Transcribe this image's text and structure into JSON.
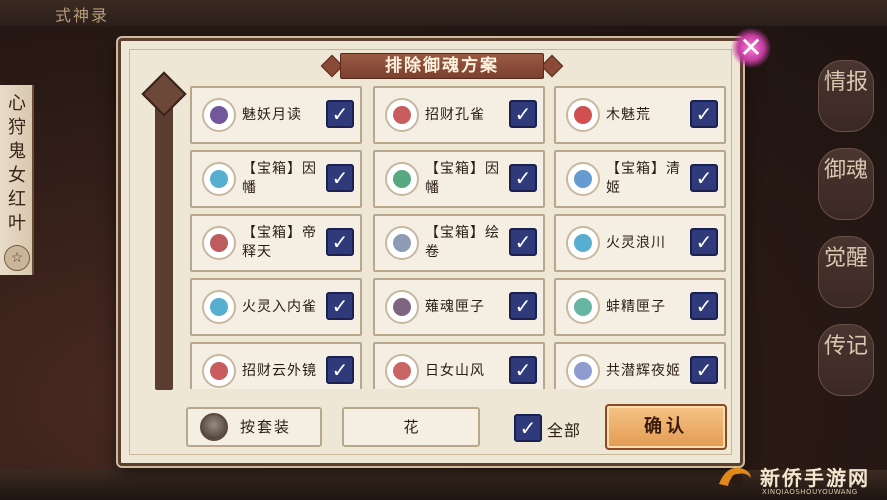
{
  "header": {
    "title": "式神录"
  },
  "left_panel": {
    "name": "心狩鬼女红叶",
    "button": "☆"
  },
  "right_tabs": [
    "情报",
    "御魂",
    "觉醒",
    "传记"
  ],
  "dialog": {
    "title": "排除御魂方案",
    "close": "✕",
    "cards": [
      {
        "label": "魅妖月读",
        "checked": "✓",
        "accent": "#5a3a8a"
      },
      {
        "label": "招财孔雀",
        "checked": "✓",
        "accent": "#c04040"
      },
      {
        "label": "木魅荒",
        "checked": "✓",
        "accent": "#c83030"
      },
      {
        "label": "【宝箱】因幡",
        "checked": "✓",
        "accent": "#3aa0c8"
      },
      {
        "label": "【宝箱】因幡",
        "checked": "✓",
        "accent": "#3a9a6a"
      },
      {
        "label": "【宝箱】清姬",
        "checked": "✓",
        "accent": "#4a8ac8"
      },
      {
        "label": "【宝箱】帝释天",
        "checked": "✓",
        "accent": "#b04040"
      },
      {
        "label": "【宝箱】绘卷",
        "checked": "✓",
        "accent": "#7a8aa8"
      },
      {
        "label": "火灵浪川",
        "checked": "✓",
        "accent": "#3aa0c8"
      },
      {
        "label": "火灵入内雀",
        "checked": "✓",
        "accent": "#3aa0c8"
      },
      {
        "label": "薙魂匣子",
        "checked": "✓",
        "accent": "#6a4a6a"
      },
      {
        "label": "蚌精匣子",
        "checked": "✓",
        "accent": "#4aa890"
      },
      {
        "label": "招财云外镜",
        "checked": "✓",
        "accent": "#c04040"
      },
      {
        "label": "日女山风",
        "checked": "✓",
        "accent": "#c04a4a"
      },
      {
        "label": "共潜辉夜姬",
        "checked": "✓",
        "accent": "#7a8ac8"
      }
    ],
    "suit_button": "按套装",
    "filter_value": "花",
    "select_all": {
      "checked": "✓",
      "label": "全部"
    },
    "confirm": "确认"
  },
  "watermark": {
    "text": "新侨手游网",
    "sub": "XINQIAOSHOUYOUWANG"
  }
}
